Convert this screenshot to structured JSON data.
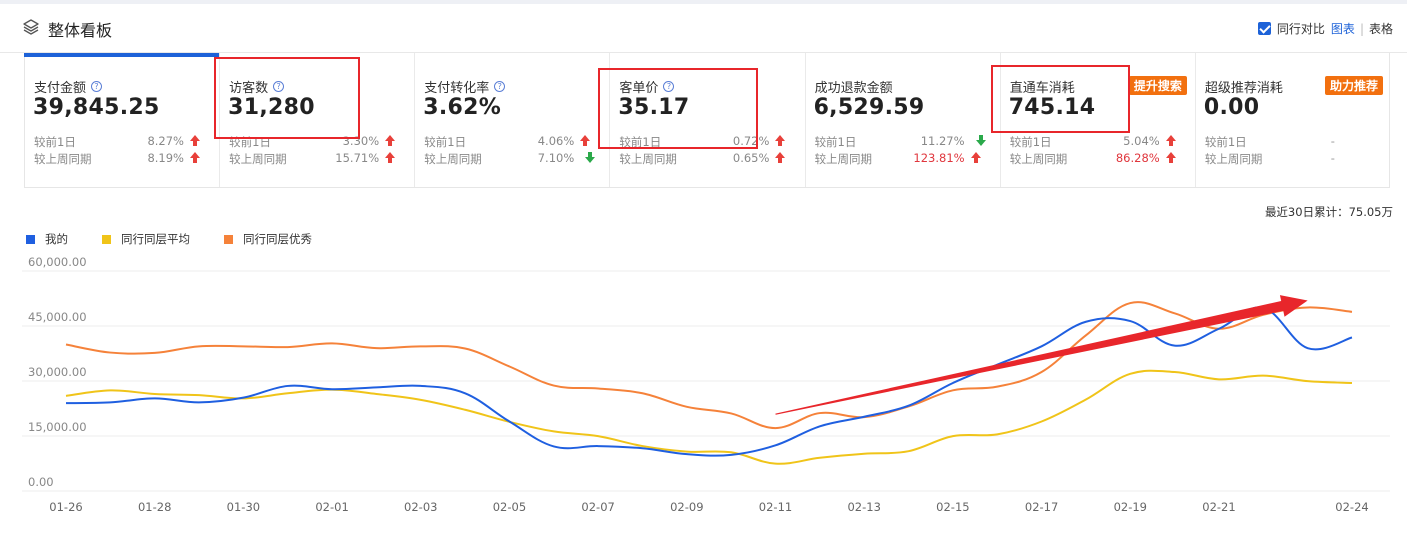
{
  "header": {
    "title": "整体看板",
    "compare_label": "同行对比",
    "view_chart": "图表",
    "view_table": "表格",
    "compare_checked": true
  },
  "metrics": [
    {
      "label": "支付金额",
      "help": true,
      "value": "39,845.25",
      "day_label": "较前1日",
      "day_pct": "8.27%",
      "day_dir": "up",
      "week_label": "较上周同期",
      "week_pct": "8.19%",
      "week_dir": "up",
      "highlight": false,
      "active": true
    },
    {
      "label": "访客数",
      "help": true,
      "value": "31,280",
      "day_label": "较前1日",
      "day_pct": "3.30%",
      "day_dir": "up",
      "week_label": "较上周同期",
      "week_pct": "15.71%",
      "week_dir": "up",
      "highlight": true
    },
    {
      "label": "支付转化率",
      "help": true,
      "value": "3.62%",
      "day_label": "较前1日",
      "day_pct": "4.06%",
      "day_dir": "up",
      "week_label": "较上周同期",
      "week_pct": "7.10%",
      "week_dir": "down",
      "highlight": false
    },
    {
      "label": "客单价",
      "help": true,
      "value": "35.17",
      "day_label": "较前1日",
      "day_pct": "0.72%",
      "day_dir": "up",
      "week_label": "较上周同期",
      "week_pct": "0.65%",
      "week_dir": "up",
      "highlight": true
    },
    {
      "label": "成功退款金额",
      "help": false,
      "value": "6,529.59",
      "day_label": "较前1日",
      "day_pct": "11.27%",
      "day_dir": "down",
      "week_label": "较上周同期",
      "week_pct": "123.81%",
      "week_dir": "up",
      "week_red": true,
      "highlight": false
    },
    {
      "label": "直通车消耗",
      "help": false,
      "value": "745.14",
      "badge": "提升搜索",
      "day_label": "较前1日",
      "day_pct": "5.04%",
      "day_dir": "up",
      "week_label": "较上周同期",
      "week_pct": "86.28%",
      "week_dir": "up",
      "week_red": true,
      "highlight": true
    },
    {
      "label": "超级推荐消耗",
      "help": false,
      "value": "0.00",
      "badge": "助力推荐",
      "day_label": "较前1日",
      "day_pct": "-",
      "day_dir": "none",
      "week_label": "较上周同期",
      "week_pct": "-",
      "week_dir": "none",
      "highlight": false
    }
  ],
  "total_text": "最近30日累计：75.05万",
  "colors": {
    "accent": "#1d62d8",
    "mine": "#1f5fe0",
    "avg": "#f0c419",
    "excellent": "#f5823a",
    "annotation": "#e8262b",
    "badge": "#f2700f"
  },
  "chart_data": {
    "type": "line",
    "x": [
      "01-26",
      "01-27",
      "01-28",
      "01-29",
      "01-30",
      "01-31",
      "02-01",
      "02-02",
      "02-03",
      "02-04",
      "02-05",
      "02-06",
      "02-07",
      "02-08",
      "02-09",
      "02-10",
      "02-11",
      "02-12",
      "02-13",
      "02-14",
      "02-15",
      "02-16",
      "02-17",
      "02-18",
      "02-19",
      "02-20",
      "02-21",
      "02-22",
      "02-23",
      "02-24"
    ],
    "x_tick_labels": [
      "01-26",
      "01-28",
      "01-30",
      "02-01",
      "02-03",
      "02-05",
      "02-07",
      "02-09",
      "02-11",
      "02-13",
      "02-15",
      "02-17",
      "02-19",
      "02-21",
      "02-24"
    ],
    "y_tick_labels": [
      "60,000.00",
      "45,000.00",
      "30,000.00",
      "15,000.00",
      "0.00"
    ],
    "ylim": [
      0,
      60000
    ],
    "legend_position": "top-left",
    "grid": "horizontal",
    "series": [
      {
        "name": "我的",
        "color": "#1f5fe0",
        "values": [
          21500,
          21700,
          22800,
          21700,
          23000,
          26200,
          25300,
          25800,
          26200,
          24200,
          16500,
          9700,
          9800,
          9200,
          7600,
          7400,
          10000,
          15200,
          17800,
          20800,
          27000,
          32000,
          37000,
          43700,
          43900,
          37200,
          41800,
          47500,
          36500,
          39400
        ]
      },
      {
        "name": "同行同层平均",
        "color": "#f0c419",
        "values": [
          23500,
          25000,
          24000,
          23700,
          22800,
          24200,
          25200,
          24000,
          22400,
          19700,
          16400,
          13800,
          12500,
          9800,
          8300,
          8100,
          5000,
          6600,
          7700,
          8400,
          12500,
          13000,
          16500,
          22500,
          29500,
          30000,
          28000,
          29000,
          27500,
          27000
        ]
      },
      {
        "name": "同行同层优秀",
        "color": "#f5823a",
        "values": [
          37500,
          35300,
          35200,
          37000,
          37000,
          36800,
          37800,
          36500,
          37000,
          36400,
          31500,
          26300,
          25500,
          24200,
          20500,
          18700,
          14700,
          18800,
          17700,
          20600,
          25000,
          26000,
          30000,
          40000,
          48800,
          46000,
          41800,
          45600,
          47600,
          46400
        ]
      }
    ],
    "annotation": {
      "type": "arrow",
      "from_x": "02-11",
      "from_y": 18500,
      "to_x": "02-23",
      "to_y": 49500
    }
  }
}
